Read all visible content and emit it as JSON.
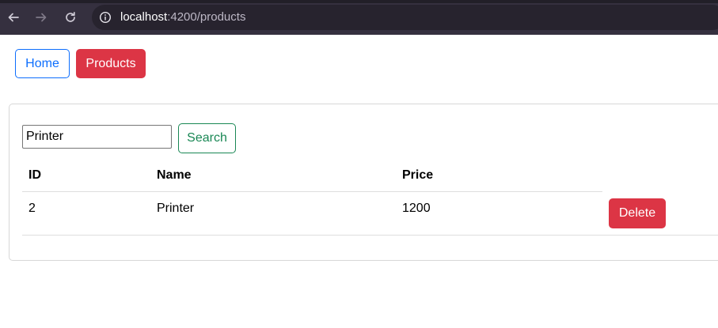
{
  "browser": {
    "url_host": "localhost",
    "url_path": ":4200/products",
    "icons": {
      "back": "back-arrow-icon",
      "forward": "forward-arrow-icon",
      "reload": "reload-icon",
      "site_info": "info-icon"
    }
  },
  "nav": {
    "home_label": "Home",
    "products_label": "Products"
  },
  "search": {
    "value": "Printer",
    "button_label": "Search"
  },
  "table": {
    "headers": [
      "ID",
      "Name",
      "Price"
    ],
    "rows": [
      {
        "id": "2",
        "name": "Printer",
        "price": "1200",
        "action_label": "Delete"
      }
    ]
  },
  "colors": {
    "primary": "#0d6efd",
    "danger": "#dc3545",
    "success": "#198754",
    "chrome": "#35303f"
  }
}
